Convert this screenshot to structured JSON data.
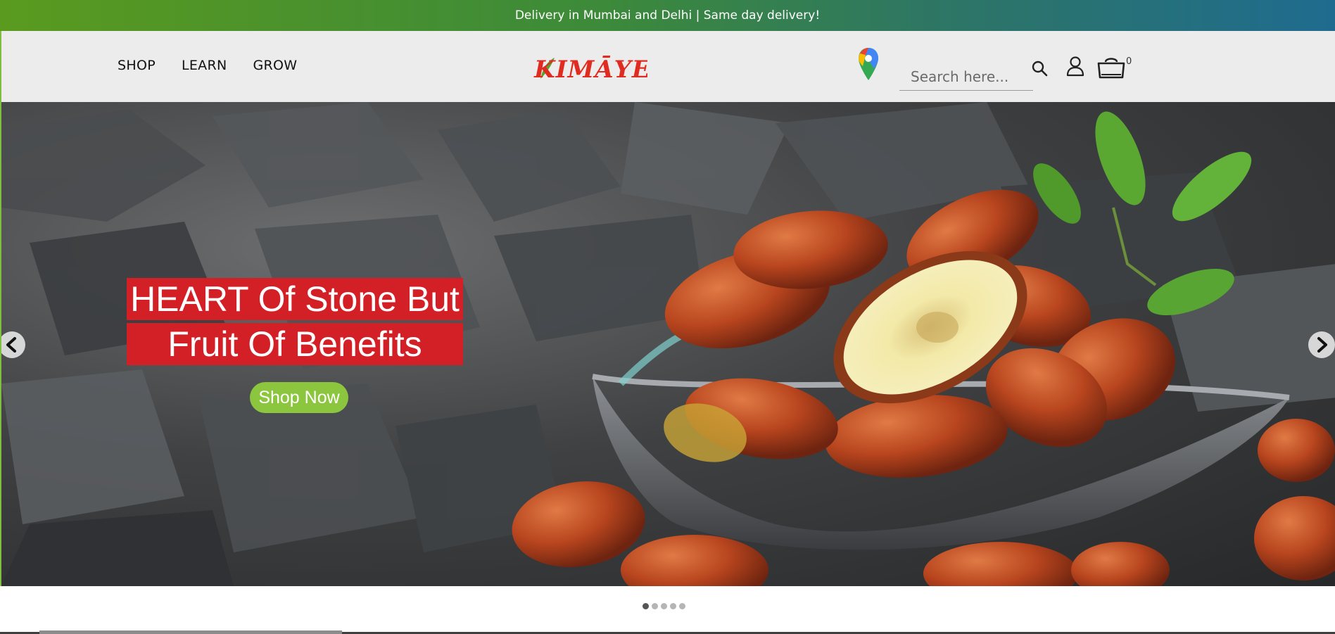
{
  "announcement": {
    "text": "Delivery in Mumbai and Delhi | Same day delivery!"
  },
  "header": {
    "nav": [
      {
        "label": "SHOP"
      },
      {
        "label": "LEARN"
      },
      {
        "label": "GROW"
      }
    ],
    "logo_text": "KIMĀYE",
    "search": {
      "placeholder": "Search here...",
      "value": ""
    },
    "cart_count": "0",
    "icons": {
      "location": "map-pin-icon",
      "search": "search-icon",
      "account": "user-icon",
      "cart": "shopping-bag-icon"
    }
  },
  "hero": {
    "headline_line1": "HEART Of Stone But",
    "headline_line2": "Fruit Of Benefits",
    "cta_label": "Shop Now",
    "slide_count": 5,
    "active_slide": 1
  },
  "colors": {
    "brand_red": "#d31f26",
    "cta_green": "#8cc63f",
    "announce_gradient_start": "#5a9a1f",
    "announce_gradient_end": "#1f6b8f"
  }
}
